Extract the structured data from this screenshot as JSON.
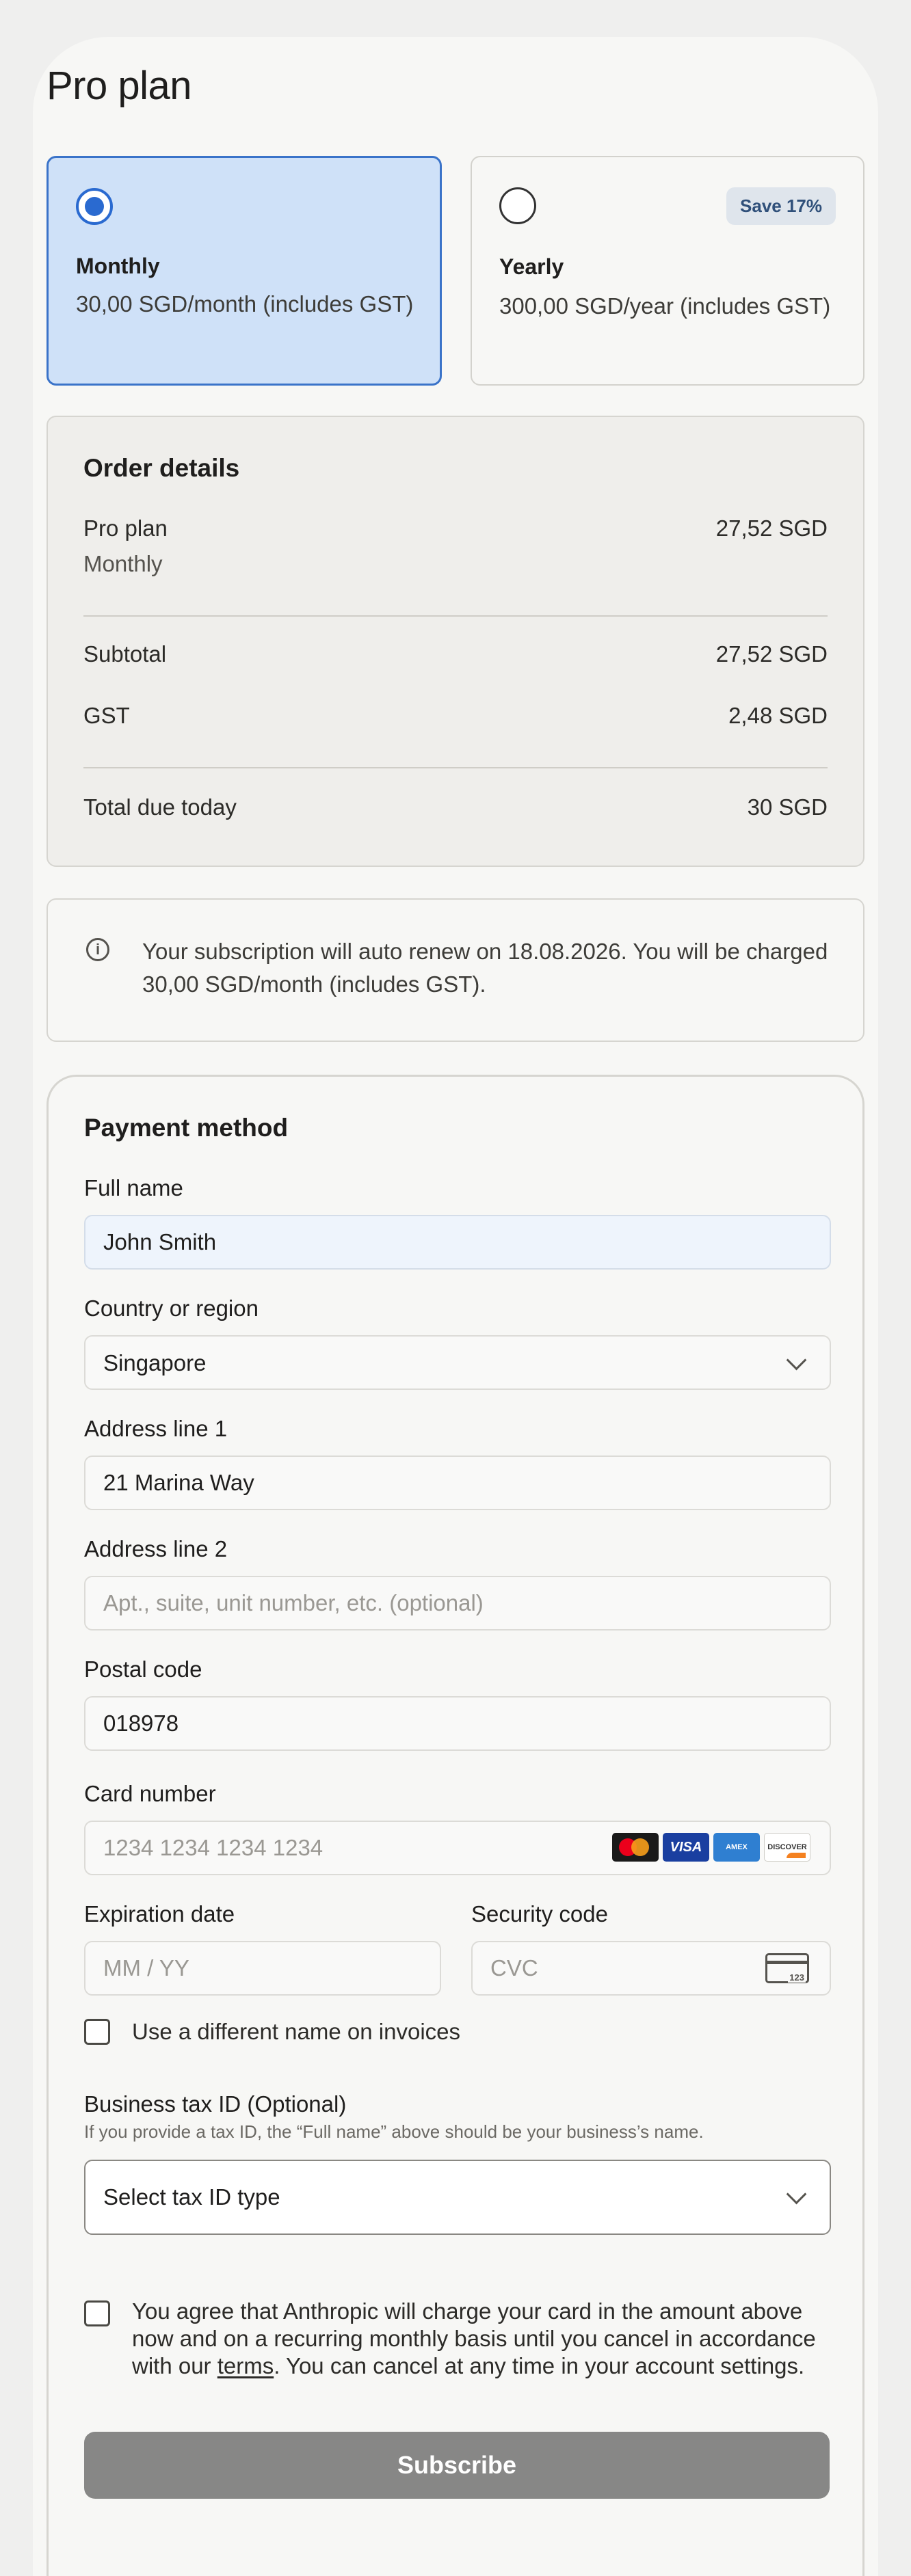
{
  "page": {
    "title": "Pro plan"
  },
  "plans": {
    "monthly": {
      "name": "Monthly",
      "price": "30,00 SGD/month (includes GST)",
      "selected": true
    },
    "yearly": {
      "name": "Yearly",
      "price": "300,00 SGD/year (includes GST)",
      "badge": "Save 17%",
      "selected": false
    }
  },
  "order": {
    "title": "Order details",
    "item_name": "Pro plan",
    "item_period": "Monthly",
    "item_price": "27,52 SGD",
    "subtotal_label": "Subtotal",
    "subtotal_value": "27,52 SGD",
    "tax_label": "GST",
    "tax_value": "2,48 SGD",
    "total_label": "Total due today",
    "total_value": "30 SGD"
  },
  "notice": {
    "icon": "info-icon",
    "text": "Your subscription will auto renew on 18.08.2026. You will be charged 30,00 SGD/month (includes GST)."
  },
  "payment": {
    "title": "Payment method",
    "full_name": {
      "label": "Full name",
      "value": "John Smith"
    },
    "country": {
      "label": "Country or region",
      "value": "Singapore"
    },
    "address1": {
      "label": "Address line 1",
      "value": "21 Marina Way"
    },
    "address2": {
      "label": "Address line 2",
      "placeholder": "Apt., suite, unit number, etc. (optional)"
    },
    "postal": {
      "label": "Postal code",
      "value": "018978"
    },
    "card": {
      "label": "Card number",
      "placeholder": "1234 1234 1234 1234",
      "brands": [
        "mastercard-icon",
        "visa-icon",
        "amex-icon",
        "discover-icon"
      ]
    },
    "expiry": {
      "label": "Expiration date",
      "placeholder": "MM / YY"
    },
    "cvc": {
      "label": "Security code",
      "placeholder": "CVC",
      "icon_digits": "123"
    },
    "invoice_name_checkbox": "Use a different name on invoices",
    "tax_id": {
      "label": "Business tax ID (Optional)",
      "helper": "If you provide a tax ID, the “Full name” above should be your business’s name.",
      "select_placeholder": "Select tax ID type"
    },
    "agreement": {
      "before": "You agree that Anthropic will charge your card in the amount above now and on a recurring monthly basis until you cancel in accordance with our ",
      "link": "terms",
      "after": ". You can cancel at any time in your account settings."
    },
    "subscribe_label": "Subscribe"
  },
  "colors": {
    "accent": "#2a6ad0",
    "selected_card_bg": "#cfe1f8",
    "button_disabled": "#878786"
  }
}
